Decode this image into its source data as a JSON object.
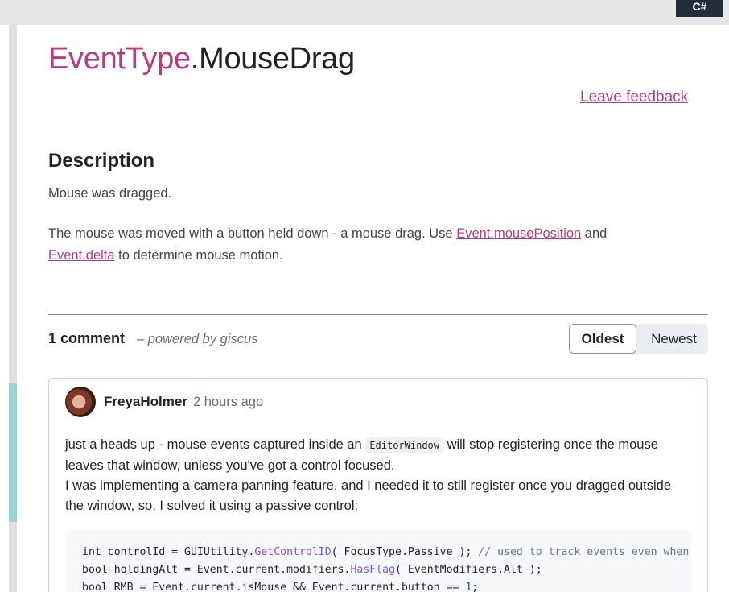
{
  "header": {
    "lang_button": "C#"
  },
  "page": {
    "title_class": "EventType",
    "title_member": ".MouseDrag",
    "feedback_link": "Leave feedback",
    "description_heading": "Description",
    "description_short": "Mouse was dragged.",
    "p2_text1": "The mouse was moved with a button held down - a mouse drag. Use ",
    "p2_link1": "Event.mousePosition",
    "p2_text2": " and ",
    "p2_link2": "Event.delta",
    "p2_text3": " to determine mouse motion."
  },
  "comments": {
    "count_label": "1 comment",
    "powered": "– powered by giscus",
    "sort_oldest": "Oldest",
    "sort_newest": "Newest",
    "items": [
      {
        "author": "FreyaHolmer",
        "time": "2 hours ago",
        "text_a": "just a heads up - mouse events captured inside an ",
        "inline_code": "EditorWindow",
        "text_b": " will stop registering once the mouse leaves that window, unless you've got a control focused.",
        "text_c": "I was implementing a camera panning feature, and I needed it to still register once you dragged outside the window, so, I solved it using a passive control:",
        "code": {
          "l1_a": "int controlId = GUIUtility.",
          "l1_fn": "GetControlID",
          "l1_b": "( FocusType.Passive ); ",
          "l1_cm": "// used to track events even when the mouse is outside",
          "l2_a": "bool holdingAlt = Event.current.modifiers.",
          "l2_fn": "HasFlag",
          "l2_b": "( EventModifiers.Alt );",
          "l3_a": "bool RMB = Event.current.isMouse && Event.current.button == ",
          "l3_num": "1",
          "l3_b": ";"
        }
      }
    ]
  }
}
